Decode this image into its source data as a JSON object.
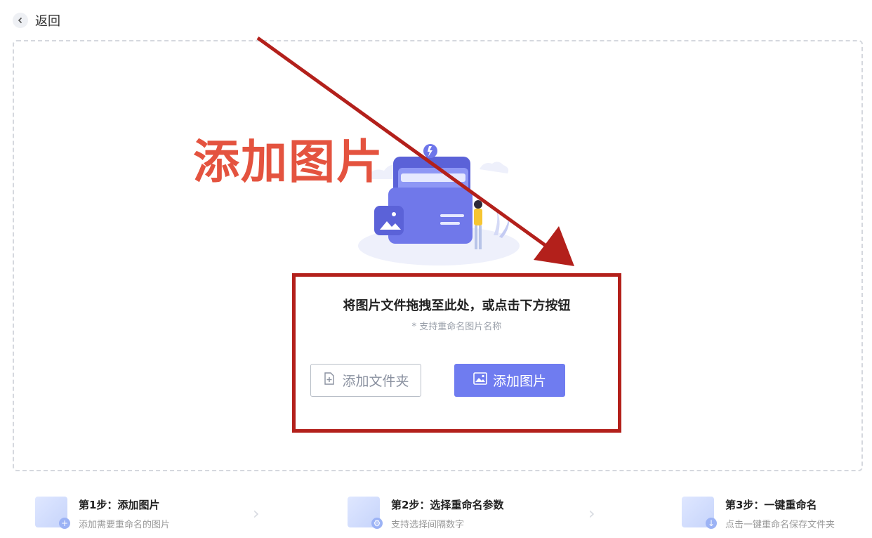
{
  "nav": {
    "back_label": "返回"
  },
  "annotation": {
    "title": "添加图片",
    "color": "#e4533f",
    "box_color": "#b3201b"
  },
  "dropzone": {
    "hint": "将图片文件拖拽至此处，或点击下方按钮",
    "sub_hint": "* 支持重命名图片名称"
  },
  "buttons": {
    "add_folder": "添加文件夹",
    "add_image": "添加图片"
  },
  "steps": [
    {
      "title": "第1步：添加图片",
      "desc": "添加需要重命名的图片",
      "icon": "image-add-icon"
    },
    {
      "title": "第2步：选择重命名参数",
      "desc": "支持选择间隔数字",
      "icon": "settings-file-icon"
    },
    {
      "title": "第3步：一键重命名",
      "desc": "点击一键重命名保存文件夹",
      "icon": "download-image-icon"
    }
  ],
  "colors": {
    "accent": "#6f7cf0",
    "dashed_border": "#d5d8de"
  }
}
